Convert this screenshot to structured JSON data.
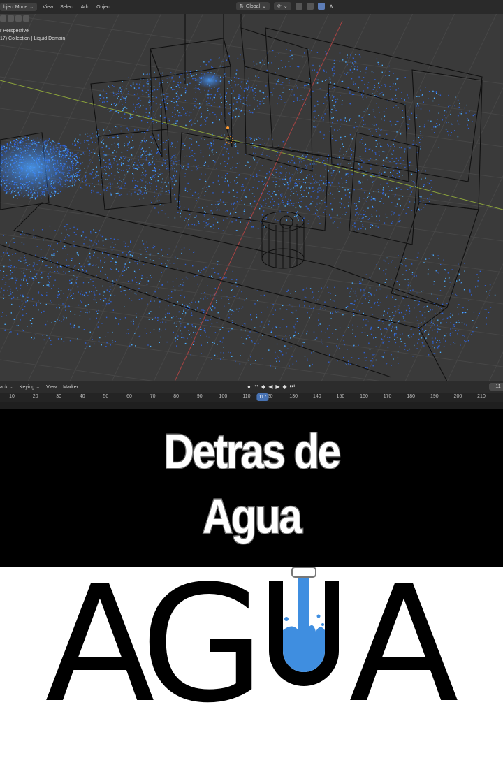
{
  "blender": {
    "topbar": {
      "mode_label": "bject Mode",
      "menus": [
        "View",
        "Select",
        "Add",
        "Object"
      ],
      "orientation_label": "Global"
    },
    "viewport": {
      "perspective_label": "r Perspective",
      "collection_label": "17) Collection | Liquid Domain"
    },
    "timeline": {
      "menus": [
        "ack",
        "Keying",
        "View",
        "Marker"
      ],
      "ticks": [
        "10",
        "20",
        "30",
        "40",
        "50",
        "60",
        "70",
        "80",
        "90",
        "100",
        "110",
        "20",
        "130",
        "140",
        "150",
        "160",
        "170",
        "180",
        "190",
        "200",
        "210"
      ],
      "current_frame": "117",
      "frame_field": "11"
    }
  },
  "title": {
    "line1": "Detras de",
    "line2": "Agua"
  },
  "logo": {
    "text": "AGUA",
    "letters": [
      "A",
      "G",
      "U",
      "A"
    ],
    "water_color": "#3f8ee0",
    "ink_color": "#000000"
  },
  "colors": {
    "viewport_bg": "#3b3b3b",
    "particles": "#2f6fe0",
    "axis_x": "#b34040",
    "axis_y": "#8ca43a",
    "title_band": "#000000"
  }
}
